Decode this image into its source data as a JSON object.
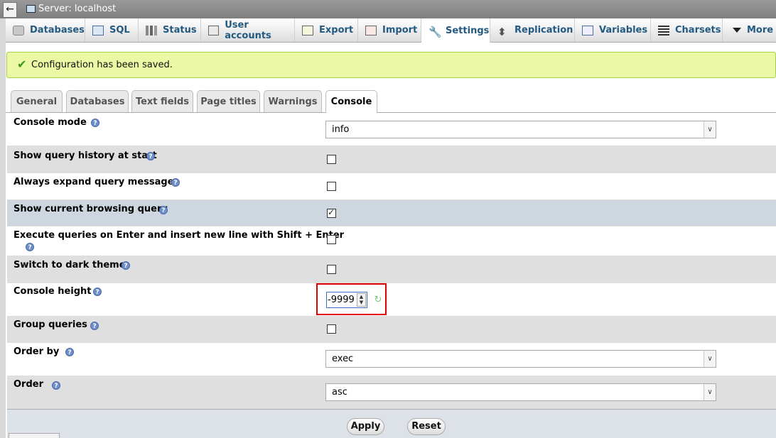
{
  "server_bar": {
    "title": "Server: localhost",
    "back_glyph": "←"
  },
  "main_tabs": [
    {
      "label": "Databases",
      "icon": "database-icon"
    },
    {
      "label": "SQL",
      "icon": "sql-icon"
    },
    {
      "label": "Status",
      "icon": "status-icon"
    },
    {
      "label": "User accounts",
      "icon": "user-accounts-icon"
    },
    {
      "label": "Export",
      "icon": "export-icon"
    },
    {
      "label": "Import",
      "icon": "import-icon"
    },
    {
      "label": "Settings",
      "icon": "wrench-icon",
      "active": true
    },
    {
      "label": "Replication",
      "icon": "replication-icon"
    },
    {
      "label": "Variables",
      "icon": "variables-icon"
    },
    {
      "label": "Charsets",
      "icon": "charsets-icon"
    },
    {
      "label": "More",
      "icon": "chevron-down-icon"
    }
  ],
  "message": {
    "text": "Configuration has been saved.",
    "icon": "check-icon"
  },
  "sub_tabs": [
    {
      "label": "General"
    },
    {
      "label": "Databases"
    },
    {
      "label": "Text fields"
    },
    {
      "label": "Page titles"
    },
    {
      "label": "Warnings"
    },
    {
      "label": "Console",
      "active": true
    }
  ],
  "settings": {
    "console_mode": {
      "label": "Console mode",
      "value": "info"
    },
    "show_query_history": {
      "label": "Show query history at start",
      "checked": false
    },
    "always_expand": {
      "label": "Always expand query messages",
      "checked": false
    },
    "show_browsing_query": {
      "label": "Show current browsing query",
      "checked": true
    },
    "execute_on_enter": {
      "label": "Execute queries on Enter and insert new line with Shift + Enter",
      "checked": false
    },
    "dark_theme": {
      "label": "Switch to dark theme",
      "checked": false
    },
    "console_height": {
      "label": "Console height",
      "value": "-9999"
    },
    "group_queries": {
      "label": "Group queries",
      "checked": false
    },
    "order_by": {
      "label": "Order by",
      "value": "exec"
    },
    "order": {
      "label": "Order",
      "value": "asc"
    }
  },
  "help_glyph": "?",
  "buttons": {
    "apply": "Apply",
    "reset": "Reset"
  },
  "colors": {
    "message_bg": "#ebf8a4",
    "highlight_row": "#ced6df",
    "error_outline": "#e00000"
  }
}
